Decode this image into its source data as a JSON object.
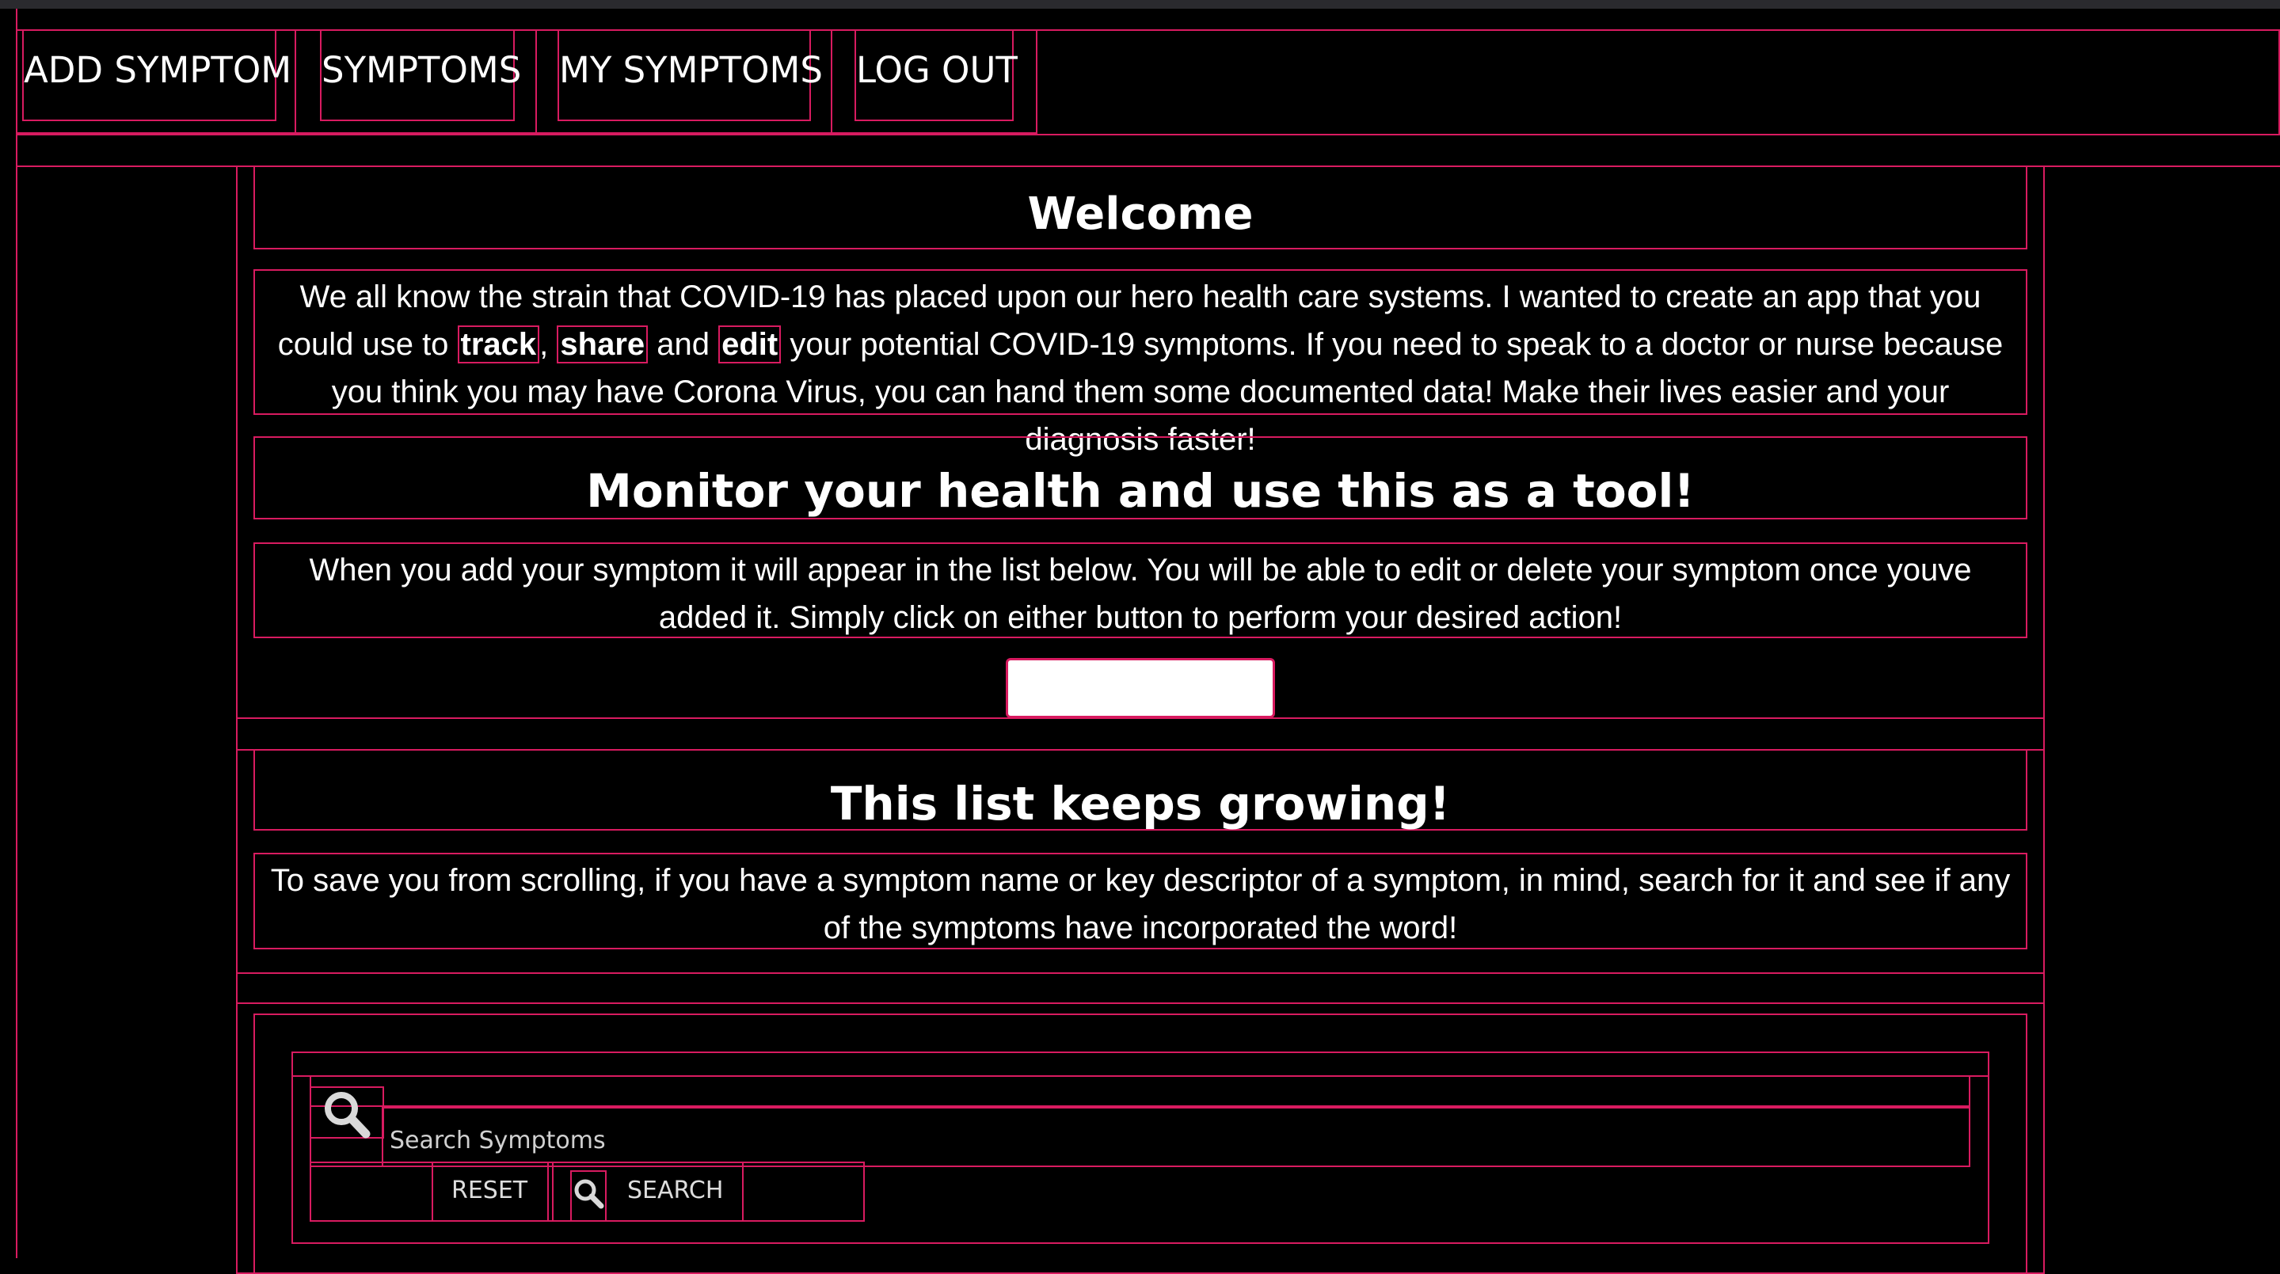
{
  "nav": {
    "items": [
      {
        "label": "ADD SYMPTOM"
      },
      {
        "label": "SYMPTOMS"
      },
      {
        "label": "MY SYMPTOMS"
      },
      {
        "label": "LOG OUT"
      }
    ]
  },
  "welcome": {
    "title": "Welcome",
    "p_1": "We all know the strain that COVID-19 has placed upon our hero health care systems. I wanted to create an app that you could use to ",
    "track": "track",
    "comma": ", ",
    "share": "share",
    "and": " and ",
    "edit": "edit",
    "p_2": " your potential COVID-19 symptoms. If you need to speak to a doctor or nurse because you think you may have Corona Virus, you can hand them some documented data! Make their lives easier and your diagnosis faster!"
  },
  "monitor": {
    "title": "Monitor your health and use this as a tool!",
    "text": "When you add your symptom it will appear in the list below. You will be able to edit or delete your symptom once youve added it. Simply click on either button to perform your desired action!"
  },
  "growing": {
    "title": "This list keeps growing!",
    "text": "To save you from scrolling, if you have a symptom name or key descriptor of a symptom, in mind, search for it and see if any of the symptoms have incorporated the word!"
  },
  "search": {
    "placeholder": "Search Symptoms",
    "reset_label": "RESET",
    "search_label": "SEARCH",
    "icon": "magnifier-icon"
  },
  "colors": {
    "accent": "#d81b60",
    "background": "#000000",
    "text": "#ffffff"
  }
}
